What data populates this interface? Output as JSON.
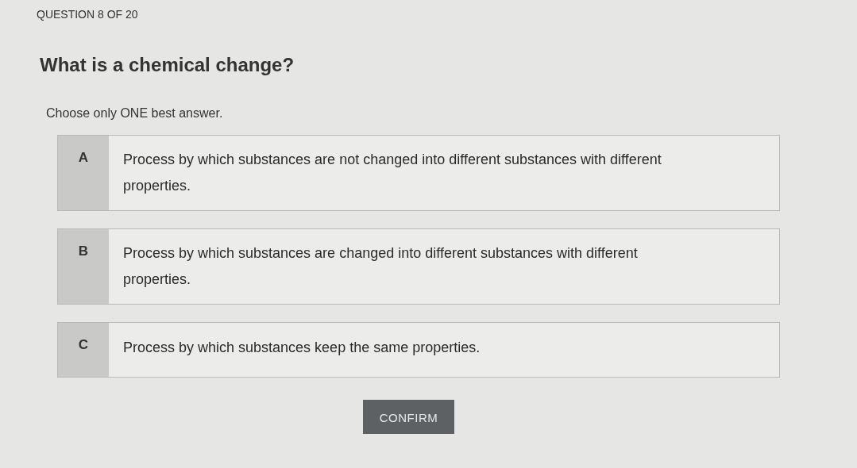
{
  "progress": "QUESTION 8 OF 20",
  "question": "What is a chemical change?",
  "instruction": "Choose only ONE best answer.",
  "options": [
    {
      "letter": "A",
      "text": "Process by which substances are not changed into different substances with different properties.",
      "selected": false
    },
    {
      "letter": "B",
      "text": "Process by which substances are changed into different substances with different properties.",
      "selected": false
    },
    {
      "letter": "C",
      "text": "Process by which substances keep the same properties.",
      "selected": false
    }
  ],
  "confirm": {
    "label": "CONFIRM",
    "disabled": true
  }
}
